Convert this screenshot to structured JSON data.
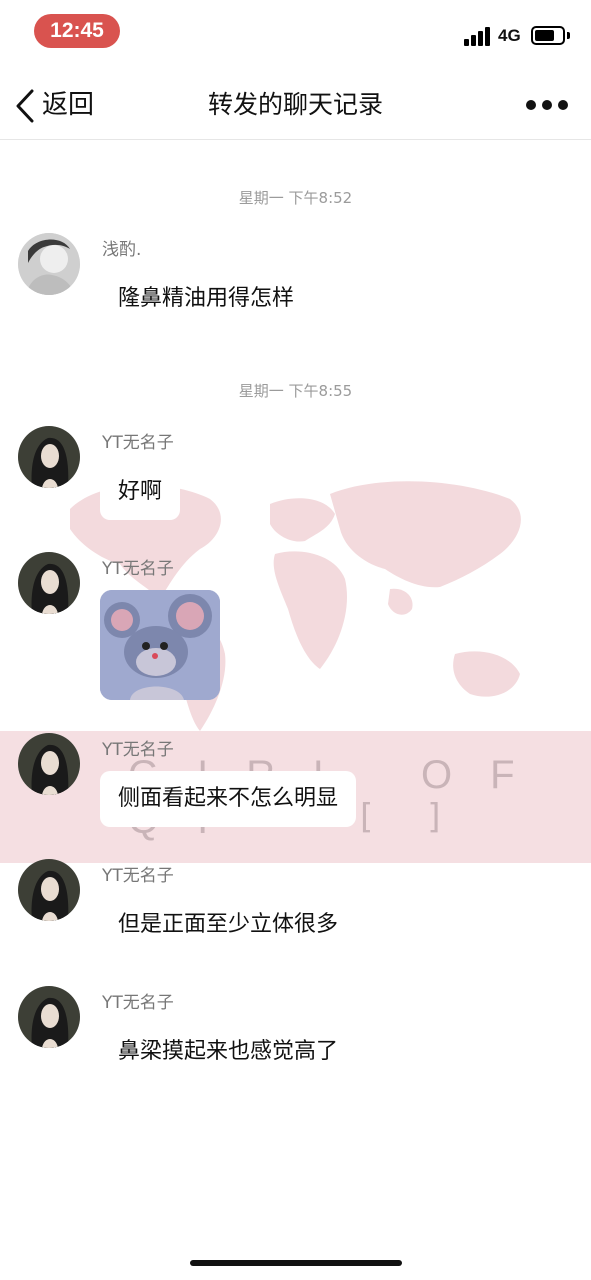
{
  "status_bar": {
    "time": "12:45",
    "network": "4G",
    "signal_icon": "signal-icon",
    "battery_icon": "battery-icon"
  },
  "nav": {
    "back_label": "返回",
    "title": "转发的聊天记录",
    "back_icon": "chevron-left-icon",
    "more_icon": "more-icon"
  },
  "chat": {
    "time_separators": [
      "星期一 下午8:52",
      "星期一 下午8:55"
    ],
    "messages": [
      {
        "sender": "浅酌.",
        "text": "隆鼻精油用得怎样"
      },
      {
        "sender": "YT无名子",
        "text": "好啊"
      },
      {
        "sender": "YT无名子",
        "sticker": "jerry-mouse-sticker"
      },
      {
        "sender": "YT无名子",
        "text": "侧面看起来不怎么明显"
      },
      {
        "sender": "YT无名子",
        "text": "但是正面至少立体很多"
      },
      {
        "sender": "YT无名子",
        "text": "鼻梁摸起来也感觉高了"
      }
    ],
    "background": {
      "band_text": "GIRL OF QI",
      "colors": {
        "band": "#f5dfe2",
        "map": "#f3dadd"
      }
    }
  },
  "colors": {
    "time_pill": "#d9534f"
  }
}
